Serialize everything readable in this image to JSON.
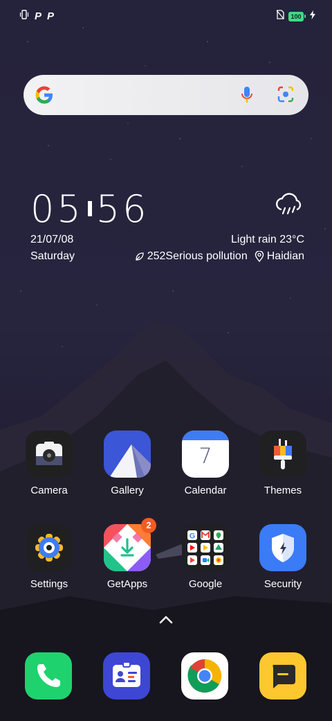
{
  "status_bar": {
    "left_icons": [
      "vibrate-icon",
      "parking-icon",
      "parking-icon"
    ],
    "battery_level": "100",
    "right_icons": [
      "no-sim-icon",
      "battery-icon",
      "charging-icon"
    ]
  },
  "search_widget": {
    "icons": [
      "google-g-icon",
      "mic-icon",
      "lens-icon"
    ]
  },
  "clock_widget": {
    "hours": "05",
    "minutes": "56",
    "date": "21/07/08",
    "day": "Saturday",
    "weather": "Light rain  23°C",
    "air_quality": "252Serious pollution",
    "location": "Haidian",
    "weather_icon": "rain-cloud-icon"
  },
  "apps_row1": [
    {
      "label": "Camera",
      "icon": "camera-icon"
    },
    {
      "label": "Gallery",
      "icon": "gallery-icon"
    },
    {
      "label": "Calendar",
      "icon": "calendar-icon",
      "calendar_day": "7"
    },
    {
      "label": "Themes",
      "icon": "themes-icon"
    }
  ],
  "apps_row2": [
    {
      "label": "Settings",
      "icon": "settings-icon"
    },
    {
      "label": "GetApps",
      "icon": "getapps-icon",
      "badge": "2"
    },
    {
      "label": "Google",
      "icon": "google-folder-icon"
    },
    {
      "label": "Security",
      "icon": "security-icon"
    }
  ],
  "dock": [
    {
      "icon": "phone-icon"
    },
    {
      "icon": "contacts-icon"
    },
    {
      "icon": "chrome-icon"
    },
    {
      "icon": "messages-icon"
    }
  ],
  "colors": {
    "background": "#24203a",
    "accent_green": "#1ed36e",
    "calendar_blue": "#3f7cf4",
    "security_blue": "#3b7bf6",
    "messages_yellow": "#fdc72f",
    "badge_orange": "#f25b21"
  }
}
